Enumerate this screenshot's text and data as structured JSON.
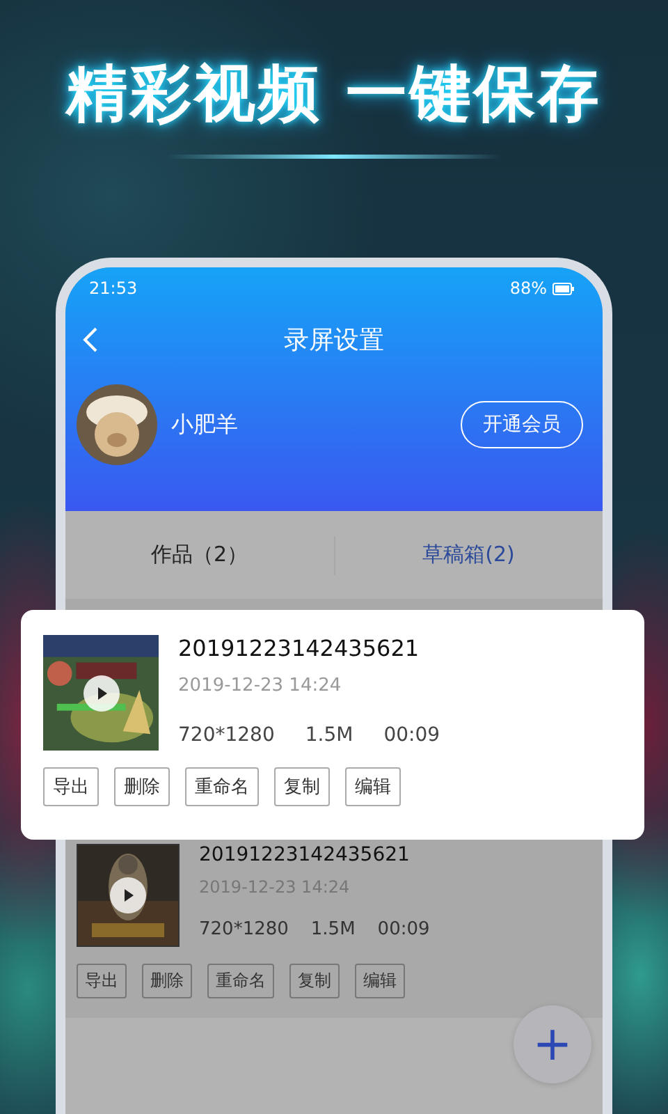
{
  "headline": "精彩视频 一键保存",
  "status_bar": {
    "time": "21:53",
    "battery_text": "88%"
  },
  "header": {
    "title": "录屏设置"
  },
  "profile": {
    "name": "小肥羊",
    "vip_button": "开通会员"
  },
  "tabs": [
    {
      "label": "作品（2）",
      "selected": false
    },
    {
      "label": "草稿箱(2)",
      "selected": true
    }
  ],
  "featured_video": {
    "name": "20191223142435621",
    "date": "2019-12-23 14:24",
    "resolution": "720*1280",
    "size": "1.5M",
    "duration": "00:09",
    "actions": [
      "导出",
      "删除",
      "重命名",
      "复制",
      "编辑"
    ]
  },
  "videos": [
    {
      "name": "20191223142435621",
      "date": "2019-12-23 14:24",
      "resolution": "720*1280",
      "size": "1.5M",
      "duration": "00:09",
      "actions": [
        "导出",
        "删除",
        "重命名",
        "复制",
        "编辑"
      ]
    }
  ],
  "fab": {
    "label": "+"
  }
}
